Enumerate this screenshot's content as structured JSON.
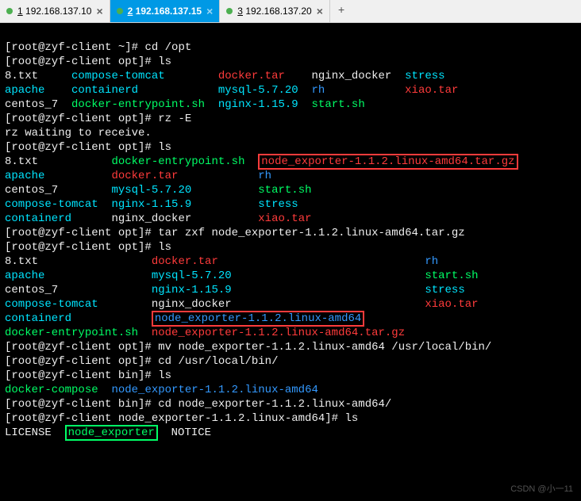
{
  "tabs": [
    {
      "num": "1",
      "ip": "192.168.137.10"
    },
    {
      "num": "2",
      "ip": "192.168.137.15"
    },
    {
      "num": "3",
      "ip": "192.168.137.20"
    }
  ],
  "prompts": {
    "home": "[root@zyf-client ~]#",
    "opt": "[root@zyf-client opt]#",
    "bin": "[root@zyf-client bin]#",
    "ne": "[root@zyf-client node_exporter-1.1.2.linux-amd64]#"
  },
  "cmds": {
    "cdopt": "cd /opt",
    "ls": "ls",
    "rz": "rz -E",
    "rzwait": "rz waiting to receive.",
    "tar": "tar zxf node_exporter-1.1.2.linux-amd64.tar.gz",
    "mv": "mv node_exporter-1.1.2.linux-amd64 /usr/local/bin/",
    "cdbin": "cd /usr/local/bin/",
    "cdne": "cd node_exporter-1.1.2.linux-amd64/"
  },
  "ls1": {
    "c1": [
      "8.txt",
      "apache",
      "centos_7"
    ],
    "c2": [
      "compose-tomcat",
      "containerd",
      "docker-entrypoint.sh"
    ],
    "c3": [
      "docker.tar",
      "mysql-5.7.20",
      "nginx-1.15.9"
    ],
    "c4": [
      "nginx_docker",
      "rh",
      "start.sh"
    ],
    "c5": [
      "stress",
      "xiao.tar",
      ""
    ]
  },
  "ls2": {
    "c1": [
      "8.txt",
      "apache",
      "centos_7",
      "compose-tomcat",
      "containerd"
    ],
    "c2": [
      "docker-entrypoint.sh",
      "docker.tar",
      "mysql-5.7.20",
      "nginx-1.15.9",
      "nginx_docker"
    ],
    "c3": [
      "node_exporter-1.1.2.linux-amd64.tar.gz",
      "rh",
      "start.sh",
      "stress",
      "xiao.tar"
    ]
  },
  "ls3": {
    "c1": [
      "8.txt",
      "apache",
      "centos_7",
      "compose-tomcat",
      "containerd",
      "docker-entrypoint.sh"
    ],
    "c2": [
      "docker.tar",
      "mysql-5.7.20",
      "nginx-1.15.9",
      "nginx_docker",
      "node_exporter-1.1.2.linux-amd64",
      "node_exporter-1.1.2.linux-amd64.tar.gz"
    ],
    "c3": [
      "rh",
      "start.sh",
      "stress",
      "xiao.tar",
      "",
      ""
    ]
  },
  "lsbin": {
    "a": "docker-compose",
    "b": "node_exporter-1.1.2.linux-amd64"
  },
  "lsne": {
    "a": "LICENSE",
    "b": "node_exporter",
    "c": "NOTICE"
  },
  "watermark": "CSDN @小一11"
}
